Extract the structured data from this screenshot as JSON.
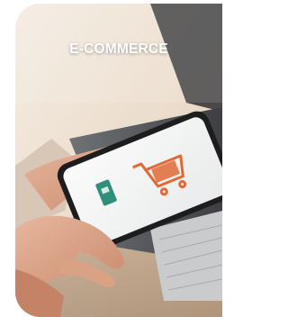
{
  "card": {
    "title": "E-COMMERCE"
  },
  "photo": {
    "subject": "hands-holding-smartphone-with-shopping-cart",
    "colors": {
      "accent": "#e06a37",
      "screen_icon": "#2f8f7a"
    }
  }
}
